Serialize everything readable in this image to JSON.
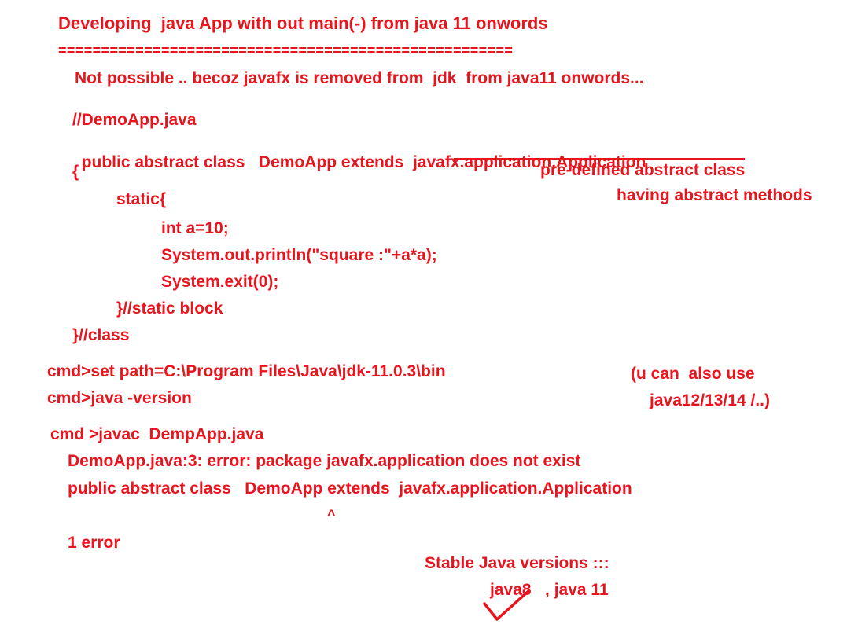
{
  "heading": "Developing  java App with out main(-) from java 11 onwords",
  "separator": "=====================================================",
  "note": "Not possible .. becoz javafx is removed from  jdk  from java11 onwords...",
  "code": {
    "comment": "//DemoApp.java",
    "class_decl_prefix": "public abstract class   DemoApp extends  ",
    "class_decl_super": "javafx.application.Application",
    "open_brace": "{",
    "static_open": "static{",
    "line_int": "int a=10;",
    "line_print": "System.out.println(\"square :\"+a*a);",
    "line_exit": "System.exit(0);",
    "static_close": "}//static block",
    "class_close": "}//class"
  },
  "annotation": {
    "line1": "pre-defined abstract class",
    "line2": "having abstract methods"
  },
  "cmd": {
    "set_path": "cmd>set path=C:\\Program Files\\Java\\jdk-11.0.3\\bin",
    "version": "cmd>java -version",
    "javac": "cmd >javac  DempApp.java",
    "error_line": "DemoApp.java:3: error: package javafx.application does not exist",
    "error_source": "public abstract class   DemoApp extends  javafx.application.Application",
    "caret": "^",
    "error_count": "1 error"
  },
  "side_note": {
    "line1": "(u can  also use",
    "line2": "java12/13/14 /..)"
  },
  "stable": {
    "title": "Stable Java versions :::",
    "versions": "java8   , java 11"
  },
  "colors": {
    "ink": "#e8141e",
    "background": "#ffffff"
  }
}
